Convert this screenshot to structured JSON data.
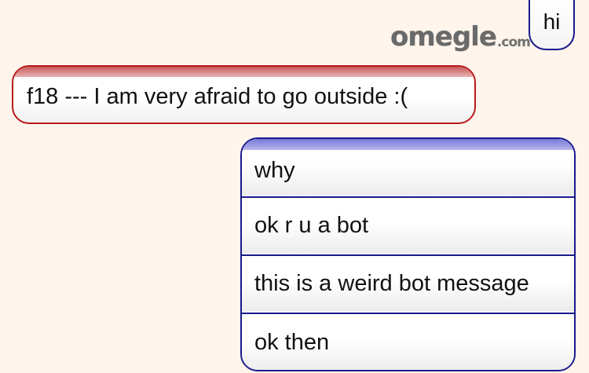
{
  "logo": {
    "main": "omegle",
    "tld": ".com"
  },
  "top_message": {
    "text": "hi"
  },
  "stranger_message": {
    "text": "f18 --- I am very afraid to go outside :("
  },
  "reply_options": [
    {
      "text": "why"
    },
    {
      "text": "ok r u a bot"
    },
    {
      "text": "this is a weird bot message"
    },
    {
      "text": "ok then"
    }
  ],
  "colors": {
    "background": "#fff5ec",
    "stranger_border": "#b81a1a",
    "you_border": "#1a1a8c",
    "logo_gray": "#6f6f6f"
  }
}
